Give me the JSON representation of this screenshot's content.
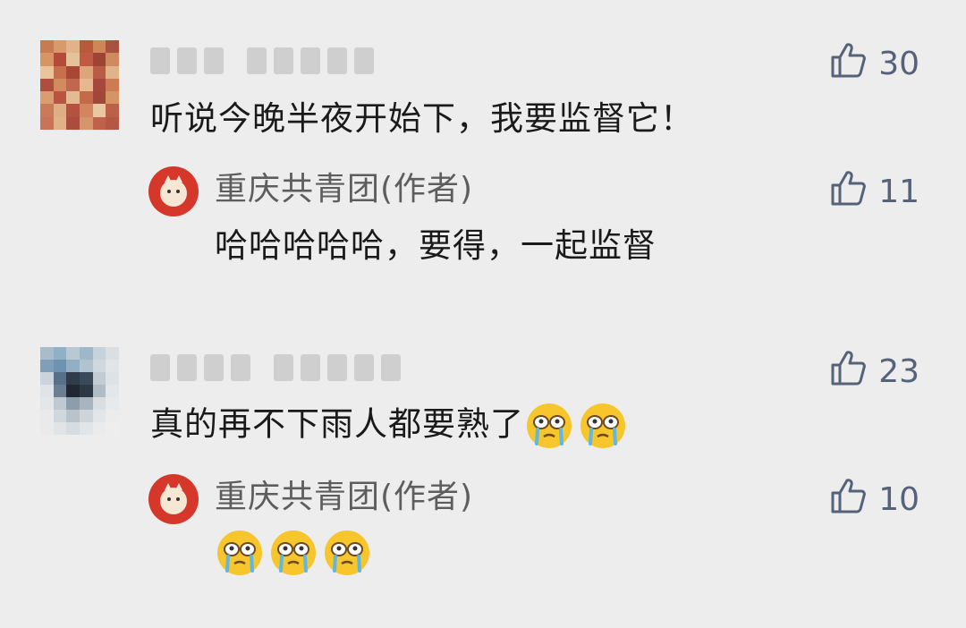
{
  "comments": [
    {
      "text": "听说今晚半夜开始下，我要监督它！",
      "likes": "30",
      "reply": {
        "author": "重庆共青团(作者)",
        "text": "哈哈哈哈哈，要得，一起监督",
        "likes": "11"
      }
    },
    {
      "text": "真的再不下雨人都要熟了",
      "emoji_count": 2,
      "likes": "23",
      "reply": {
        "author": "重庆共青团(作者)",
        "text": "",
        "emoji_count": 3,
        "likes": "10"
      }
    }
  ],
  "icons": {
    "like": "thumbs-up-icon",
    "emoji": "crying-face-emoji"
  },
  "colors": {
    "background": "#ededed",
    "like": "#55627a",
    "author": "#5d5d5d",
    "author_avatar": "#d6372b"
  }
}
